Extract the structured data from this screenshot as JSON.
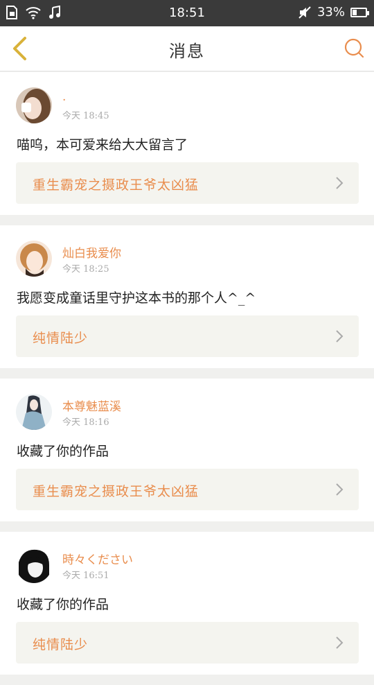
{
  "status_bar": {
    "time": "18:51",
    "battery_percent": "33%",
    "battery_level": 0.33,
    "left_icons": [
      "sim-card-icon",
      "wifi-icon",
      "music-note-icon"
    ],
    "right_icons": [
      "mute-icon",
      "battery-icon"
    ]
  },
  "header": {
    "title": "消息",
    "back_icon": "chevron-left-icon",
    "search_icon": "search-icon"
  },
  "colors": {
    "accent": "#e98d4d",
    "back_icon": "#d9b23a",
    "status_bar_bg": "#3a3a3a",
    "card_bg": "#ffffff",
    "book_bg": "#f4f4ef",
    "page_bg": "#f0f0ee"
  },
  "messages": [
    {
      "username": ".",
      "time": "今天 18:45",
      "text": "喵呜，本可爱来给大大留言了",
      "book_title": "重生霸宠之摄政王爷太凶猛"
    },
    {
      "username": "灿白我爱你",
      "time": "今天 18:25",
      "text": "我愿变成童话里守护这本书的那个人^_^",
      "book_title": "纯情陆少"
    },
    {
      "username": "本尊魅蓝溪",
      "time": "今天 18:16",
      "text": "收藏了你的作品",
      "book_title": "重生霸宠之摄政王爷太凶猛"
    },
    {
      "username": "時々ください",
      "time": "今天 16:51",
      "text": "收藏了你的作品",
      "book_title": "纯情陆少"
    }
  ]
}
